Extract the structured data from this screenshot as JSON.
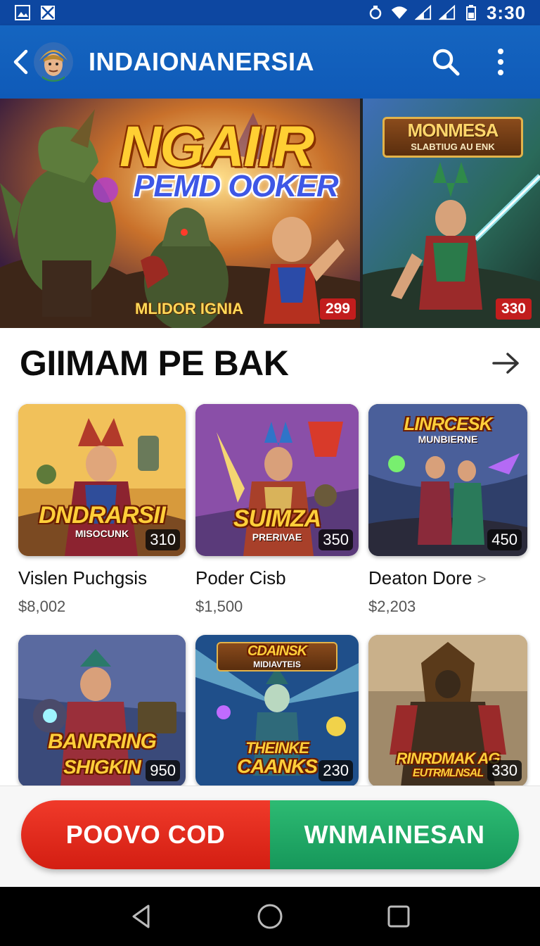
{
  "status_bar": {
    "time": "3:30",
    "icons": [
      "notification-image-icon",
      "notification-mail-icon",
      "alarm-icon",
      "wifi-icon",
      "cell-signal-icon",
      "battery-icon"
    ]
  },
  "app_bar": {
    "title": "INDAIONANERSIA",
    "icons": [
      "back-arrow-icon",
      "search-icon",
      "more-vert-icon"
    ]
  },
  "hero": {
    "main": {
      "title": "NGAIIR",
      "subtitle": "PEMD OOKER",
      "caption": "MLIDOR IGNIA",
      "price": "299"
    },
    "side": {
      "title": "MONMESA",
      "subtitle": "SLABTIUG AU ENK",
      "price": "330"
    }
  },
  "section": {
    "title": "GIIMAM PE BAK"
  },
  "games": [
    {
      "logo": "DNDRARSII",
      "logo_sub": "MISOCUNK",
      "badge": "310",
      "name": "Vislen Puchgsis",
      "price": "$8,002"
    },
    {
      "logo": "SUIMZA",
      "logo_sub": "PRERIVAE",
      "badge": "350",
      "name": "Poder Cisb",
      "price": "$1,500"
    },
    {
      "logo": "LINRCESK",
      "logo_sub": "MUNBIERNE",
      "badge": "450",
      "name": "Deaton Dore",
      "name_suffix": ">",
      "price": "$2,203"
    },
    {
      "logo": "BANRRING",
      "logo_sub": "SHIGKIN",
      "badge": "950",
      "name": "",
      "price": ""
    },
    {
      "logo": "THEINKE",
      "logo_sub": "CAANKS",
      "logo_top": "CDAINSK",
      "logo_top_sub": "MIDIAVTEIS",
      "badge": "230",
      "name": "",
      "price": ""
    },
    {
      "logo": "RINRDMAK AG",
      "logo_sub": "EUTRMLNSAL",
      "badge": "330",
      "name": "",
      "price": ""
    }
  ],
  "cta": {
    "left_label": "POOVO COD",
    "right_label": "WNMAINESAN",
    "left_color": "#e52d1f",
    "right_color": "#22a865"
  },
  "nav_bar": {
    "icons": [
      "nav-back-icon",
      "nav-home-icon",
      "nav-recents-icon"
    ]
  },
  "colors": {
    "primary": "#1565c0",
    "price_badge": "#c21d1d"
  }
}
